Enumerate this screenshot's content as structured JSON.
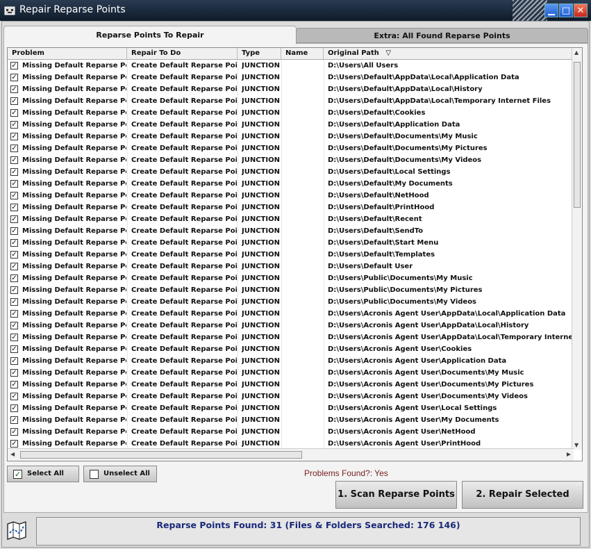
{
  "window": {
    "title": "Repair Reparse Points"
  },
  "tabs": [
    {
      "label": "Reparse Points To Repair"
    },
    {
      "label": "Extra: All Found Reparse Points"
    }
  ],
  "columns": [
    "Problem",
    "Repair To Do",
    "Type",
    "Name",
    "Original Path"
  ],
  "rows": [
    [
      "Missing Default Reparse Point",
      "Create Default Reparse Point",
      "JUNCTION",
      "",
      "D:\\Users\\All Users"
    ],
    [
      "Missing Default Reparse Point",
      "Create Default Reparse Point",
      "JUNCTION",
      "",
      "D:\\Users\\Default\\AppData\\Local\\Application Data"
    ],
    [
      "Missing Default Reparse Point",
      "Create Default Reparse Point",
      "JUNCTION",
      "",
      "D:\\Users\\Default\\AppData\\Local\\History"
    ],
    [
      "Missing Default Reparse Point",
      "Create Default Reparse Point",
      "JUNCTION",
      "",
      "D:\\Users\\Default\\AppData\\Local\\Temporary Internet Files"
    ],
    [
      "Missing Default Reparse Point",
      "Create Default Reparse Point",
      "JUNCTION",
      "",
      "D:\\Users\\Default\\Cookies"
    ],
    [
      "Missing Default Reparse Point",
      "Create Default Reparse Point",
      "JUNCTION",
      "",
      "D:\\Users\\Default\\Application Data"
    ],
    [
      "Missing Default Reparse Point",
      "Create Default Reparse Point",
      "JUNCTION",
      "",
      "D:\\Users\\Default\\Documents\\My Music"
    ],
    [
      "Missing Default Reparse Point",
      "Create Default Reparse Point",
      "JUNCTION",
      "",
      "D:\\Users\\Default\\Documents\\My Pictures"
    ],
    [
      "Missing Default Reparse Point",
      "Create Default Reparse Point",
      "JUNCTION",
      "",
      "D:\\Users\\Default\\Documents\\My Videos"
    ],
    [
      "Missing Default Reparse Point",
      "Create Default Reparse Point",
      "JUNCTION",
      "",
      "D:\\Users\\Default\\Local Settings"
    ],
    [
      "Missing Default Reparse Point",
      "Create Default Reparse Point",
      "JUNCTION",
      "",
      "D:\\Users\\Default\\My Documents"
    ],
    [
      "Missing Default Reparse Point",
      "Create Default Reparse Point",
      "JUNCTION",
      "",
      "D:\\Users\\Default\\NetHood"
    ],
    [
      "Missing Default Reparse Point",
      "Create Default Reparse Point",
      "JUNCTION",
      "",
      "D:\\Users\\Default\\PrintHood"
    ],
    [
      "Missing Default Reparse Point",
      "Create Default Reparse Point",
      "JUNCTION",
      "",
      "D:\\Users\\Default\\Recent"
    ],
    [
      "Missing Default Reparse Point",
      "Create Default Reparse Point",
      "JUNCTION",
      "",
      "D:\\Users\\Default\\SendTo"
    ],
    [
      "Missing Default Reparse Point",
      "Create Default Reparse Point",
      "JUNCTION",
      "",
      "D:\\Users\\Default\\Start Menu"
    ],
    [
      "Missing Default Reparse Point",
      "Create Default Reparse Point",
      "JUNCTION",
      "",
      "D:\\Users\\Default\\Templates"
    ],
    [
      "Missing Default Reparse Point",
      "Create Default Reparse Point",
      "JUNCTION",
      "",
      "D:\\Users\\Default User"
    ],
    [
      "Missing Default Reparse Point",
      "Create Default Reparse Point",
      "JUNCTION",
      "",
      "D:\\Users\\Public\\Documents\\My Music"
    ],
    [
      "Missing Default Reparse Point",
      "Create Default Reparse Point",
      "JUNCTION",
      "",
      "D:\\Users\\Public\\Documents\\My Pictures"
    ],
    [
      "Missing Default Reparse Point",
      "Create Default Reparse Point",
      "JUNCTION",
      "",
      "D:\\Users\\Public\\Documents\\My Videos"
    ],
    [
      "Missing Default Reparse Point",
      "Create Default Reparse Point",
      "JUNCTION",
      "",
      "D:\\Users\\Acronis Agent User\\AppData\\Local\\Application Data"
    ],
    [
      "Missing Default Reparse Point",
      "Create Default Reparse Point",
      "JUNCTION",
      "",
      "D:\\Users\\Acronis Agent User\\AppData\\Local\\History"
    ],
    [
      "Missing Default Reparse Point",
      "Create Default Reparse Point",
      "JUNCTION",
      "",
      "D:\\Users\\Acronis Agent User\\AppData\\Local\\Temporary Internet Files"
    ],
    [
      "Missing Default Reparse Point",
      "Create Default Reparse Point",
      "JUNCTION",
      "",
      "D:\\Users\\Acronis Agent User\\Cookies"
    ],
    [
      "Missing Default Reparse Point",
      "Create Default Reparse Point",
      "JUNCTION",
      "",
      "D:\\Users\\Acronis Agent User\\Application Data"
    ],
    [
      "Missing Default Reparse Point",
      "Create Default Reparse Point",
      "JUNCTION",
      "",
      "D:\\Users\\Acronis Agent User\\Documents\\My Music"
    ],
    [
      "Missing Default Reparse Point",
      "Create Default Reparse Point",
      "JUNCTION",
      "",
      "D:\\Users\\Acronis Agent User\\Documents\\My Pictures"
    ],
    [
      "Missing Default Reparse Point",
      "Create Default Reparse Point",
      "JUNCTION",
      "",
      "D:\\Users\\Acronis Agent User\\Documents\\My Videos"
    ],
    [
      "Missing Default Reparse Point",
      "Create Default Reparse Point",
      "JUNCTION",
      "",
      "D:\\Users\\Acronis Agent User\\Local Settings"
    ],
    [
      "Missing Default Reparse Point",
      "Create Default Reparse Point",
      "JUNCTION",
      "",
      "D:\\Users\\Acronis Agent User\\My Documents"
    ],
    [
      "Missing Default Reparse Point",
      "Create Default Reparse Point",
      "JUNCTION",
      "",
      "D:\\Users\\Acronis Agent User\\NetHood"
    ],
    [
      "Missing Default Reparse Point",
      "Create Default Reparse Point",
      "JUNCTION",
      "",
      "D:\\Users\\Acronis Agent User\\PrintHood"
    ]
  ],
  "controls": {
    "select_all": "Select All",
    "unselect_all": "Unselect All",
    "problems_found": "Problems Found?: Yes",
    "scan_button": "1. Scan Reparse Points",
    "repair_button": "2. Repair Selected"
  },
  "status": {
    "text": "Reparse Points Found: 31 (Files & Folders Searched: 176 146)"
  },
  "colors": {
    "title_bar": "#1a2a3e",
    "status_text": "#1a2a7a",
    "problems_text": "#7a2222"
  }
}
